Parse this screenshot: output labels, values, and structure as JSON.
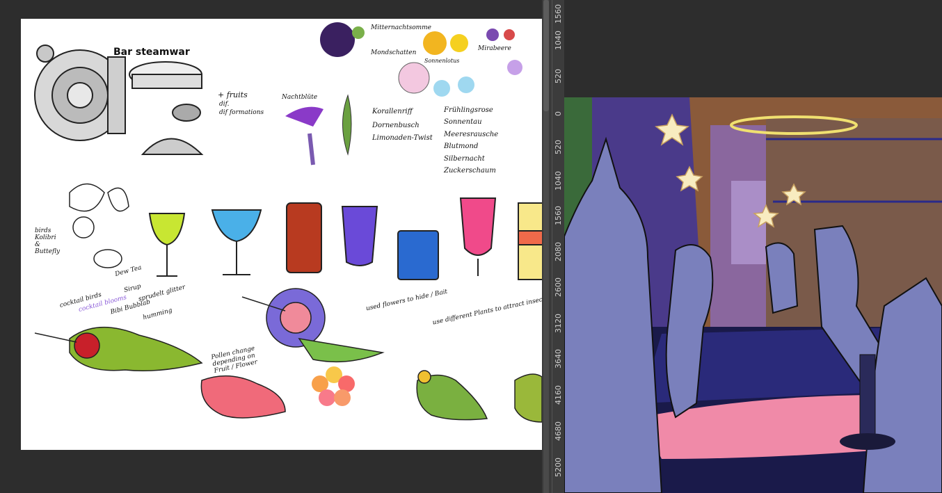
{
  "left_canvas": {
    "labels": {
      "bar_title": "Bar steamwar",
      "fruits_note": "+ fruits",
      "fruits_note2": "dif.",
      "fruits_note3": "dif formations",
      "mittern": "Mitternachtsomme",
      "mondschatten": "Mondschatten",
      "sonnenlotus": "Sonnenlotus",
      "mirabeere": "Mirabeere",
      "nachtblute": "Nachtblüte",
      "korallenriff": "Korallenriff",
      "dornenbusch": "Dornenbusch",
      "limonaden": "Limonaden-Twist",
      "fruhlingsrose": "Frühlingsrose",
      "sonnentau": "Sonnentau",
      "meeresrausche": "Meeresrausche",
      "blutmond": "Blutmond",
      "silbernacht": "Silbernacht",
      "zuckerschaum": "Zuckerschaum",
      "birds_notes": "birds Kolibri & Buttefly",
      "cocktail_birds": "cocktail birds",
      "cocktail_blooms": "cocktail blooms",
      "dew_tea": "Dew Tea",
      "bibi": "Bibi Bubblab",
      "sirup": "Sirup",
      "sprudel": "sprudelt glitter",
      "humming": "humming",
      "used_flowers": "used flowers to hide / Bait",
      "different_plants": "use different Plants to attract insects",
      "pollen": "Pollen change depending on Fruit / Flower"
    }
  },
  "ruler": {
    "ticks": [
      "1560",
      "1040",
      "520",
      "0",
      "520",
      "1040",
      "1560",
      "2080",
      "2600",
      "3120",
      "3640",
      "4160",
      "4680",
      "5200"
    ]
  },
  "colors": {
    "workspace": "#2d2d2d",
    "canvas": "#ffffff",
    "ruler": "#3c3c3c"
  }
}
